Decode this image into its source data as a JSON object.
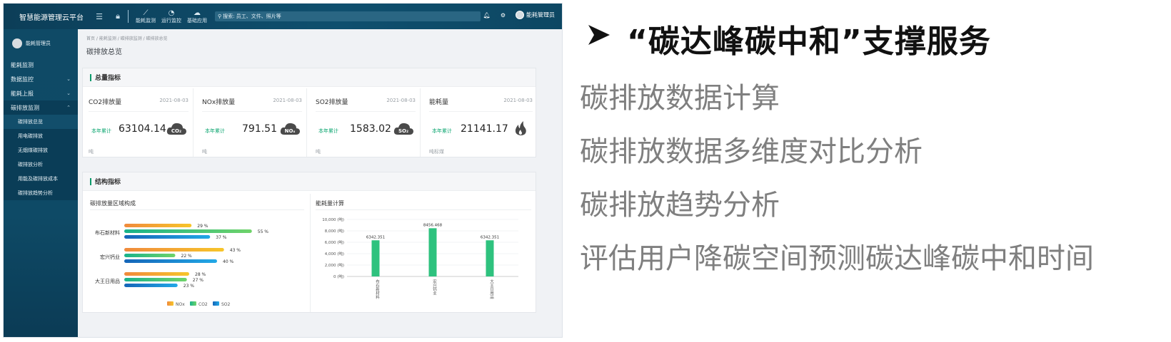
{
  "header": {
    "app_title": "智慧能源管理云平台",
    "nav": [
      {
        "label": "能耗监测",
        "icon": "line-chart-icon"
      },
      {
        "label": "运行监控",
        "icon": "pie-chart-icon"
      },
      {
        "label": "基础应用",
        "icon": "cloud-icon"
      }
    ],
    "search_text": "搜索: 员工、文件、照片等",
    "user_name": "能耗管理员"
  },
  "sidebar": {
    "user_name": "能耗管理员",
    "items": [
      {
        "label": "能耗监测"
      },
      {
        "label": "数据监控"
      },
      {
        "label": "能耗上报"
      },
      {
        "label": "碳排放监测"
      }
    ],
    "sub_items": [
      {
        "label": "碳排放总览"
      },
      {
        "label": "用电碳排放"
      },
      {
        "label": "无烟煤碳排放"
      },
      {
        "label": "碳排放分析"
      },
      {
        "label": "用能及碳排放成本"
      },
      {
        "label": "碳排放趋势分析"
      }
    ]
  },
  "breadcrumb": "首页 / 能耗监测 / 碳排放监测 / 碳排放总览",
  "page_title": "碳排放总览",
  "totals": {
    "title": "总量指标",
    "metrics": [
      {
        "name": "CO2排放量",
        "date": "2021-08-03",
        "tag": "本年累计",
        "value": "63104.14",
        "unit": "吨",
        "icon_text": "CO₂"
      },
      {
        "name": "NOx排放量",
        "date": "2021-08-03",
        "tag": "本年累计",
        "value": "791.51",
        "unit": "吨",
        "icon_text": "NOₓ"
      },
      {
        "name": "SO2排放量",
        "date": "2021-08-03",
        "tag": "本年累计",
        "value": "1583.02",
        "unit": "吨",
        "icon_text": "SO₂"
      },
      {
        "name": "能耗量",
        "date": "2021-08-03",
        "tag": "本年累计",
        "value": "21141.17",
        "unit": "吨标煤",
        "icon_text": ""
      }
    ]
  },
  "structure": {
    "title": "结构指标",
    "left_title": "碳排放量区域构成",
    "right_title": "能耗量计算"
  },
  "colors": {
    "nox": "#f5a623",
    "co2": "#2ec27e",
    "so2": "#1a8fd8",
    "accent": "#0c9a6a"
  },
  "chart_data": [
    {
      "type": "bar",
      "orientation": "horizontal",
      "title": "碳排放量区域构成",
      "categories": [
        "布石新材料",
        "宏兴钙业",
        "大王日用品"
      ],
      "series": [
        {
          "name": "NOx",
          "values": [
            29,
            43,
            28
          ]
        },
        {
          "name": "CO2",
          "values": [
            55,
            22,
            27
          ]
        },
        {
          "name": "SO2",
          "values": [
            37,
            40,
            23
          ]
        }
      ],
      "value_suffix": " %",
      "legend": "bottom-center"
    },
    {
      "type": "bar",
      "title": "能耗量计算",
      "categories": [
        "布石新材料",
        "宏兴钙业",
        "大王日用品"
      ],
      "values": [
        6342.351,
        8456.468,
        6342.351
      ],
      "y_ticks": [
        "0 (吨)",
        "2,000 (吨)",
        "4,000 (吨)",
        "6,000 (吨)",
        "8,000 (吨)",
        "10,000 (吨)"
      ],
      "ylim": [
        0,
        10000
      ],
      "grid": true
    }
  ],
  "slide": {
    "title": "“碳达峰碳中和”支撑服务",
    "bullets": [
      "碳排放数据计算",
      "碳排放数据多维度对比分析",
      "碳排放趋势分析",
      "评估用户降碳空间预测碳达峰碳中和时间"
    ]
  }
}
